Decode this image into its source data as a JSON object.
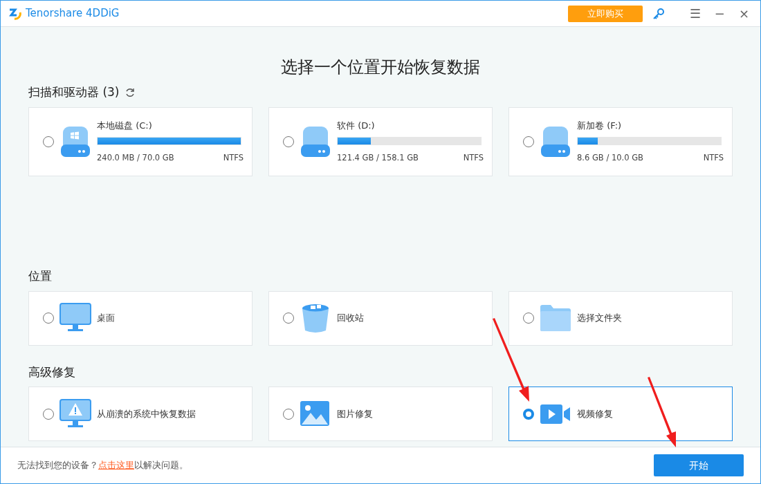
{
  "window": {
    "app_name": "Tenorshare 4DDiG",
    "buy_button": "立即购买",
    "controls": [
      "☰",
      "−",
      "×"
    ]
  },
  "heading": "选择一个位置开始恢复数据",
  "drives_section": {
    "title": "扫描和驱动器 (3)",
    "drives": [
      {
        "kind": "system",
        "name": "本地磁盘 (C:)",
        "usage": "240.0 MB / 70.0 GB",
        "fs": "NTFS",
        "level": 1.0,
        "selected": false
      },
      {
        "kind": "data",
        "name": "软件 (D:)",
        "usage": "121.4 GB / 158.1 GB",
        "fs": "NTFS",
        "level": 0.23,
        "selected": false
      },
      {
        "kind": "data",
        "name": "新加卷 (F:)",
        "usage": "8.6 GB / 10.0 GB",
        "fs": "NTFS",
        "level": 0.14,
        "selected": false
      }
    ]
  },
  "locations_section": {
    "title": "位置",
    "items": [
      {
        "kind": "desktop",
        "label": "桌面",
        "selected": false
      },
      {
        "kind": "recycle",
        "label": "回收站",
        "selected": false
      },
      {
        "kind": "folder",
        "label": "选择文件夹",
        "selected": false
      }
    ]
  },
  "advanced_section": {
    "title": "高级修复",
    "items": [
      {
        "kind": "crash",
        "label": "从崩溃的系统中恢复数据",
        "selected": false
      },
      {
        "kind": "photo",
        "label": "图片修复",
        "selected": false
      },
      {
        "kind": "video",
        "label": "视频修复",
        "selected": true
      }
    ]
  },
  "footer": {
    "help_prefix": "无法找到您的设备？",
    "help_link": "点击这里",
    "help_suffix": "以解决问题。",
    "start_button": "开始"
  }
}
